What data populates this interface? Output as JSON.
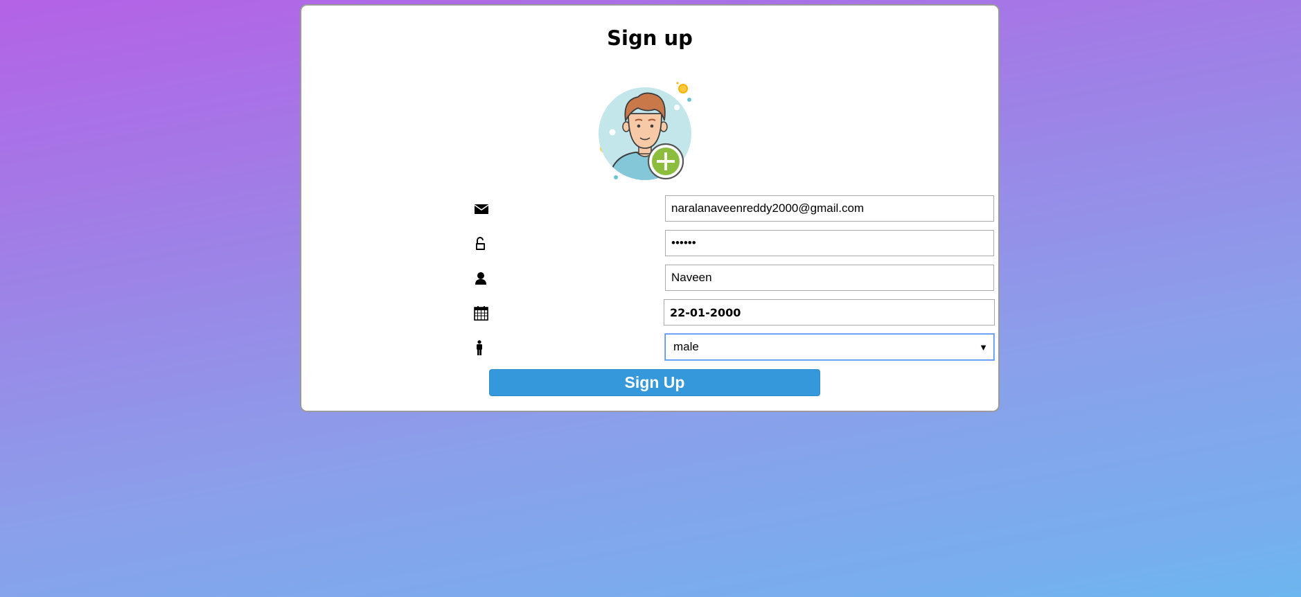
{
  "form": {
    "title": "Sign up",
    "email": {
      "value": "naralanaveenreddy2000@gmail.com",
      "icon": "envelope-icon"
    },
    "password": {
      "value": "••••••",
      "icon": "unlock-icon"
    },
    "name": {
      "value": "Naveen",
      "icon": "user-icon"
    },
    "dob": {
      "value": "22-01-2000",
      "icon": "calendar-icon"
    },
    "gender": {
      "selected": "male",
      "icon": "male-person-icon"
    },
    "submit_label": "Sign Up"
  },
  "colors": {
    "button": "#3498db",
    "card": "#ffffff",
    "gradient_top": "#b462e6",
    "gradient_bottom": "#6cb6ee"
  }
}
